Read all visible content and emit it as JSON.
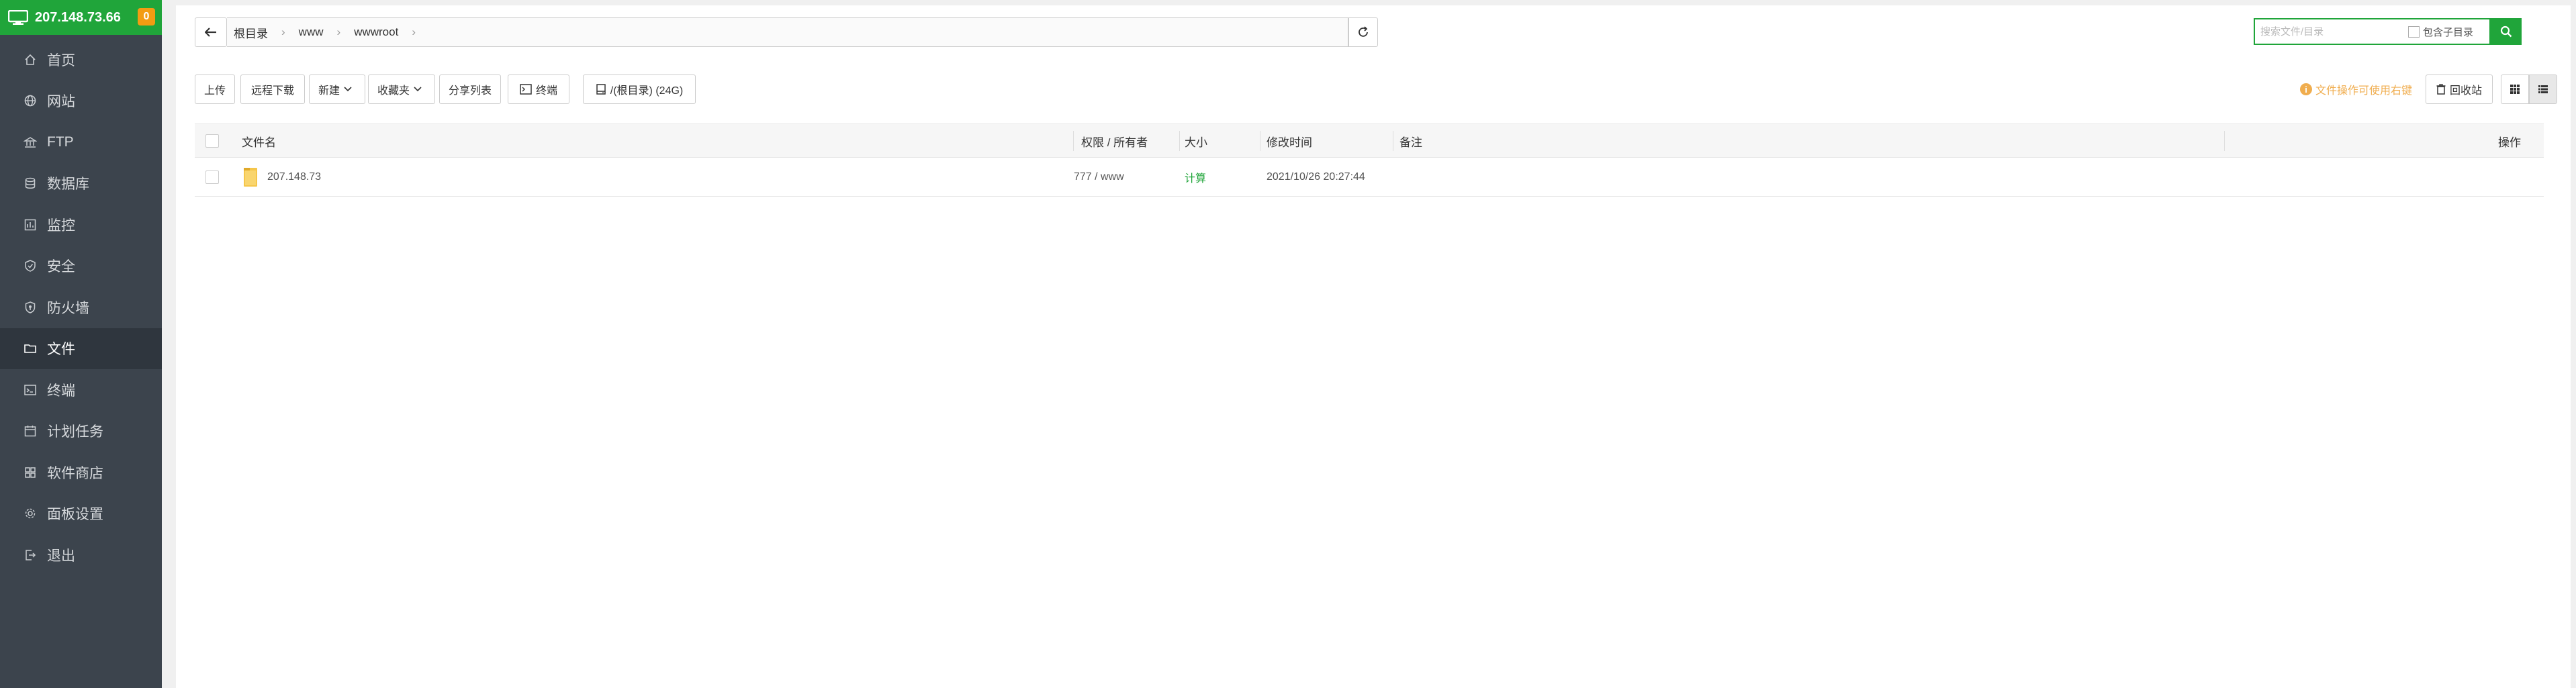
{
  "sidebar": {
    "server_ip": "207.148.73.66",
    "badge_count": "0",
    "items": [
      {
        "label": "首页",
        "icon": "home-icon"
      },
      {
        "label": "网站",
        "icon": "globe-icon"
      },
      {
        "label": "FTP",
        "icon": "ftp-icon"
      },
      {
        "label": "数据库",
        "icon": "database-icon"
      },
      {
        "label": "监控",
        "icon": "monitor-icon"
      },
      {
        "label": "安全",
        "icon": "shield-icon"
      },
      {
        "label": "防火墙",
        "icon": "firewall-icon"
      },
      {
        "label": "文件",
        "icon": "folder-icon"
      },
      {
        "label": "终端",
        "icon": "terminal-icon"
      },
      {
        "label": "计划任务",
        "icon": "calendar-icon"
      },
      {
        "label": "软件商店",
        "icon": "apps-icon"
      },
      {
        "label": "面板设置",
        "icon": "gear-icon"
      },
      {
        "label": "退出",
        "icon": "logout-icon"
      }
    ],
    "active_index": 7
  },
  "path_bar": {
    "crumbs": [
      "根目录",
      "www",
      "wwwroot"
    ]
  },
  "search": {
    "placeholder": "搜索文件/目录",
    "include_subdir_label": "包含子目录"
  },
  "toolbar": {
    "upload": "上传",
    "remote_download": "远程下载",
    "new": "新建",
    "favorites": "收藏夹",
    "share_list": "分享列表",
    "terminal": "终端",
    "disk": "/(根目录) (24G)",
    "perm_hint": "文件操作可使用右键",
    "recycle_bin": "回收站"
  },
  "table": {
    "headers": {
      "name": "文件名",
      "perm_owner": "权限 / 所有者",
      "size": "大小",
      "mtime": "修改时间",
      "remark": "备注",
      "actions": "操作"
    },
    "rows": [
      {
        "name": "207.148.73",
        "perm_owner": "777 / www",
        "size": "计算",
        "mtime": "2021/10/26 20:27:44",
        "remark": ""
      }
    ]
  },
  "colors": {
    "accent": "#20a53a",
    "sidebar_bg": "#3c444d",
    "warning": "#f0ad4e"
  }
}
